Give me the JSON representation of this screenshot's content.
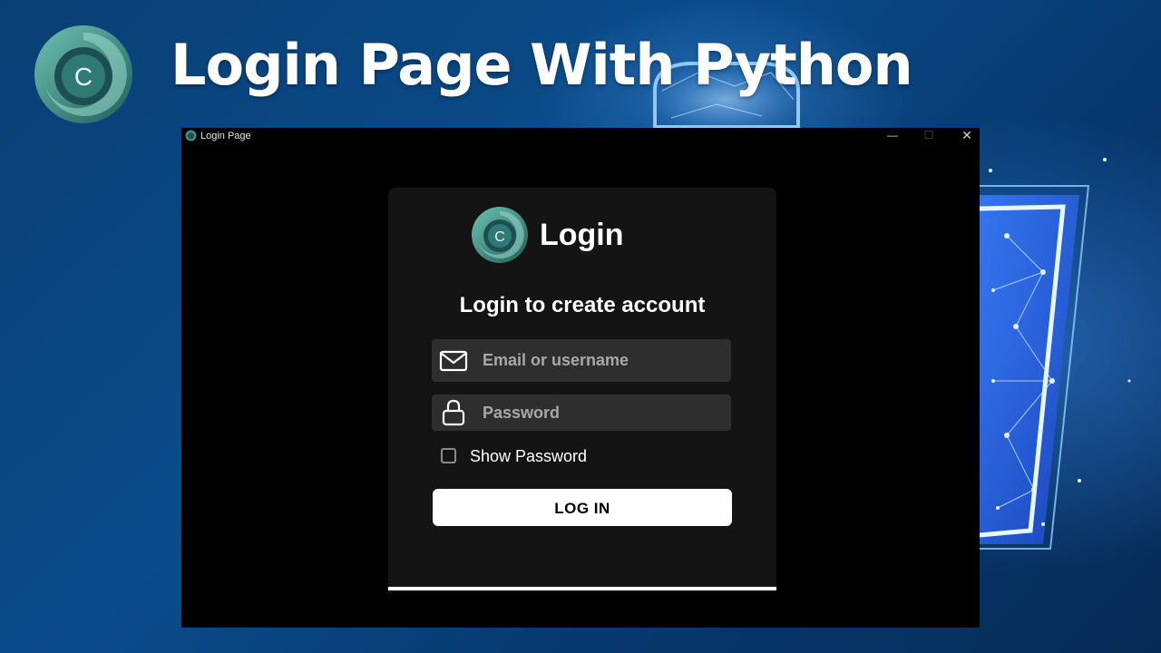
{
  "banner": {
    "title": "Login Page With Python",
    "logo_letter": "C"
  },
  "window": {
    "title": "Login Page",
    "controls": {
      "minimize": "—",
      "maximize": "☐",
      "close": "✕"
    }
  },
  "login": {
    "logo_text": "Login",
    "subtitle": "Login to create account",
    "email_placeholder": "Email or username",
    "password_placeholder": "Password",
    "show_password_label": "Show Password",
    "button_label": "LOG IN"
  },
  "colors": {
    "background": "#0a4b8a",
    "window_bg": "#000000",
    "card_bg": "#141414",
    "field_bg": "#2e2e2e",
    "logo_teal": "#3f8f86"
  }
}
